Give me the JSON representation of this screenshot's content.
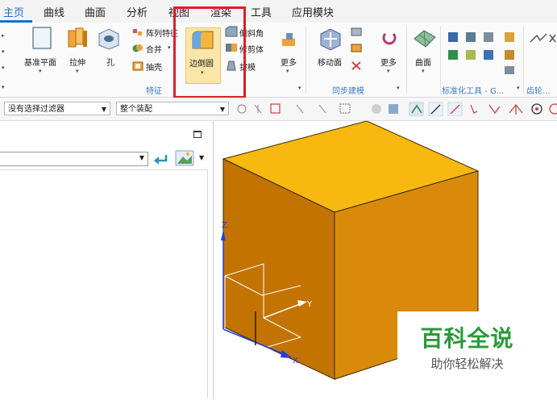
{
  "tabs": [
    "主页",
    "曲线",
    "曲面",
    "分析",
    "视图",
    "渲染",
    "工具",
    "应用模块"
  ],
  "ribbon": {
    "datum_plane": "基准平面",
    "extrude": "拉伸",
    "hole": "孔",
    "pattern_feature": "阵列特征",
    "unite": "合并",
    "shell": "抽壳",
    "edge_blend": "边倒圆",
    "chamfer": "倒斜角",
    "trim_body": "修剪体",
    "draft": "拔模",
    "more1": "更多",
    "move_face": "移动面",
    "more2": "更多",
    "surface": "曲面",
    "group_feature": "特征",
    "group_sync": "同步建模",
    "group_std": "标准化工具 - G...",
    "group_gear": "齿轮..."
  },
  "filterbar": {
    "type_filter": "没有选择过滤器",
    "scope": "整个装配"
  },
  "axes": {
    "x": "X",
    "y": "Y",
    "z": "Z"
  },
  "watermark": {
    "title": "百科全说",
    "subtitle": "助你轻松解决"
  },
  "colors": {
    "highlight": "#d9202a",
    "cube_top": "#f7b90f",
    "cube_left": "#c37300",
    "cube_right": "#d98a0b",
    "active_tab": "#1a6fc4"
  }
}
